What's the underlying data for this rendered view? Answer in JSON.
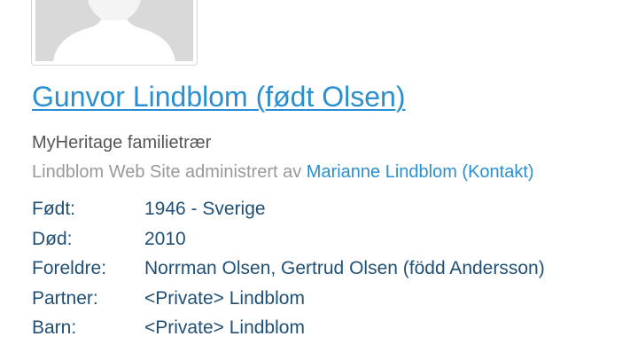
{
  "profile": {
    "photo_icon": "silhouette-placeholder",
    "name": "Gunvor Lindblom (født Olsen)",
    "source_title": "MyHeritage familietrær",
    "site_prefix": "Lindblom Web Site administrert av",
    "manager_link": "Marianne Lindblom (Kontakt)"
  },
  "facts": [
    {
      "label": "Født:",
      "value": "1946 - Sverige"
    },
    {
      "label": "Død:",
      "value": "2010"
    },
    {
      "label": "Foreldre:",
      "value": "Norrman Olsen, Gertrud Olsen (född Andersson)"
    },
    {
      "label": "Partner:",
      "value": "<Private> Lindblom"
    },
    {
      "label": "Barn:",
      "value": "<Private> Lindblom"
    }
  ],
  "colors": {
    "link": "#2a8fd0",
    "fact_text": "#1f4f75",
    "muted": "#999999",
    "heading": "#555555"
  }
}
